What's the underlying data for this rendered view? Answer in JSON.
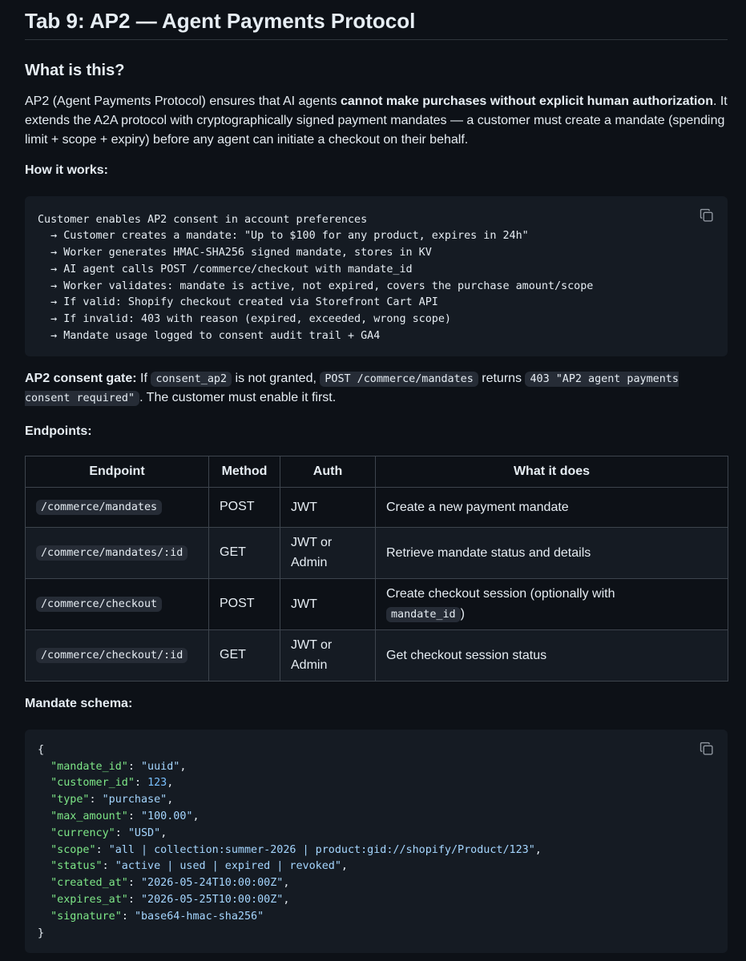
{
  "title": "Tab 9: AP2 — Agent Payments Protocol",
  "what": {
    "heading": "What is this?",
    "p1_a": "AP2 (Agent Payments Protocol) ensures that AI agents ",
    "p1_b": "cannot make purchases without explicit human authorization",
    "p1_c": ". It extends the A2A protocol with cryptographically signed payment mandates — a customer must create a mandate (spending limit + scope + expiry) before any agent can initiate a checkout on their behalf."
  },
  "how": {
    "label": "How it works:",
    "lines": [
      "Customer enables AP2 consent in account preferences",
      "  → Customer creates a mandate: \"Up to $100 for any product, expires in 24h\"",
      "  → Worker generates HMAC-SHA256 signed mandate, stores in KV",
      "  → AI agent calls POST /commerce/checkout with mandate_id",
      "  → Worker validates: mandate is active, not expired, covers the purchase amount/scope",
      "  → If valid: Shopify checkout created via Storefront Cart API",
      "  → If invalid: 403 with reason (expired, exceeded, wrong scope)",
      "  → Mandate usage logged to consent audit trail + GA4"
    ]
  },
  "gate": {
    "label": "AP2 consent gate:",
    "t1": " If ",
    "c1": "consent_ap2",
    "t2": " is not granted, ",
    "c2": "POST /commerce/mandates",
    "t3": " returns ",
    "c3": "403 \"AP2 agent payments consent required\"",
    "t4": ". The customer must enable it first."
  },
  "endpoints": {
    "label": "Endpoints:",
    "headers": [
      "Endpoint",
      "Method",
      "Auth",
      "What it does"
    ],
    "rows": [
      {
        "endpoint": "/commerce/mandates",
        "method": "POST",
        "auth": "JWT",
        "desc": "Create a new payment mandate",
        "desc_code": "",
        "desc_tail": ""
      },
      {
        "endpoint": "/commerce/mandates/:id",
        "method": "GET",
        "auth": "JWT or Admin",
        "desc": "Retrieve mandate status and details",
        "desc_code": "",
        "desc_tail": ""
      },
      {
        "endpoint": "/commerce/checkout",
        "method": "POST",
        "auth": "JWT",
        "desc": "Create checkout session (optionally with ",
        "desc_code": "mandate_id",
        "desc_tail": ")"
      },
      {
        "endpoint": "/commerce/checkout/:id",
        "method": "GET",
        "auth": "JWT or Admin",
        "desc": "Get checkout session status",
        "desc_code": "",
        "desc_tail": ""
      }
    ]
  },
  "schema": {
    "label": "Mandate schema:",
    "fields": [
      {
        "key": "\"mandate_id\"",
        "value": "\"uuid\"",
        "num": false
      },
      {
        "key": "\"customer_id\"",
        "value": "123",
        "num": true
      },
      {
        "key": "\"type\"",
        "value": "\"purchase\"",
        "num": false
      },
      {
        "key": "\"max_amount\"",
        "value": "\"100.00\"",
        "num": false
      },
      {
        "key": "\"currency\"",
        "value": "\"USD\"",
        "num": false
      },
      {
        "key": "\"scope\"",
        "value": "\"all | collection:summer-2026 | product:gid://shopify/Product/123\"",
        "num": false
      },
      {
        "key": "\"status\"",
        "value": "\"active | used | expired | revoked\"",
        "num": false
      },
      {
        "key": "\"created_at\"",
        "value": "\"2026-05-24T10:00:00Z\"",
        "num": false
      },
      {
        "key": "\"expires_at\"",
        "value": "\"2026-05-25T10:00:00Z\"",
        "num": false
      },
      {
        "key": "\"signature\"",
        "value": "\"base64-hmac-sha256\"",
        "num": false
      }
    ]
  },
  "icons": {
    "copy": "copy-icon"
  },
  "colors": {
    "bg": "#0d1117",
    "code_bg": "#151b23",
    "key": "#7ee787",
    "string": "#a5d6ff",
    "number": "#79c0ff"
  }
}
